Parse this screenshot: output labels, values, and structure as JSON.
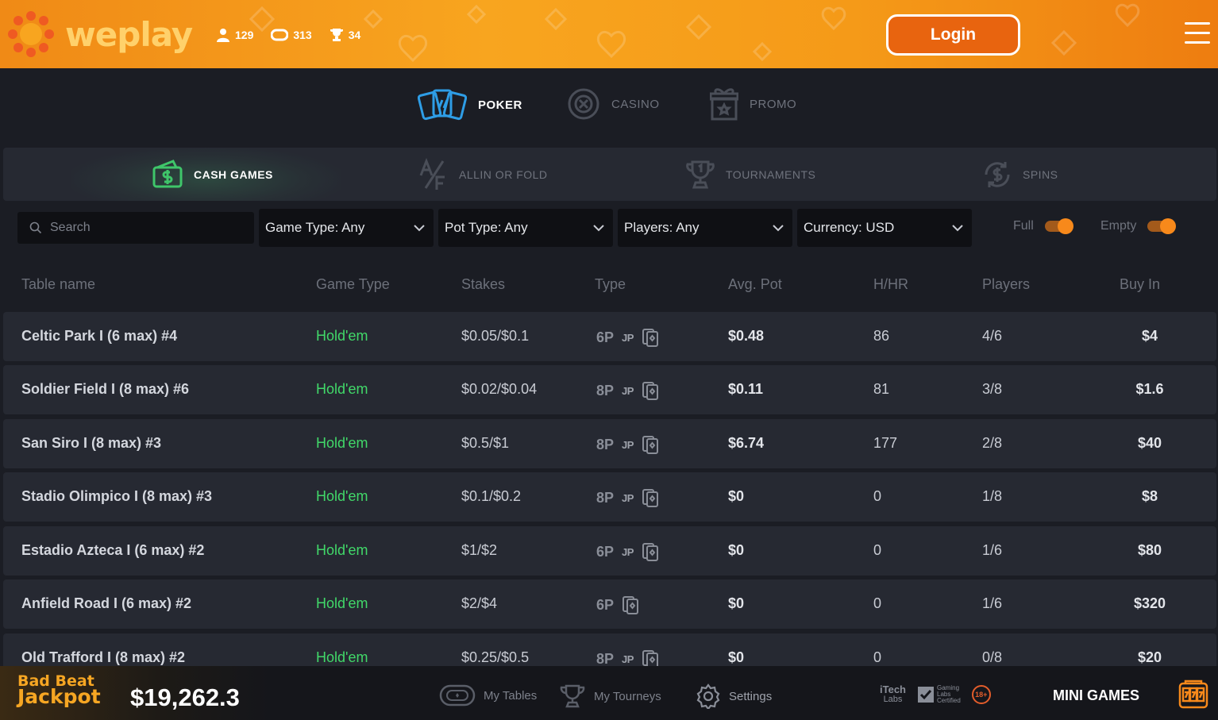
{
  "header": {
    "brand": "weplay",
    "stats": [
      {
        "icon": "user-icon",
        "value": "129"
      },
      {
        "icon": "ticket-icon",
        "value": "313"
      },
      {
        "icon": "trophy-icon",
        "value": "34"
      }
    ],
    "login_label": "Login"
  },
  "topnav": {
    "items": [
      {
        "label": "POKER",
        "icon": "cards-icon",
        "active": true
      },
      {
        "label": "CASINO",
        "icon": "chip-icon",
        "active": false
      },
      {
        "label": "PROMO",
        "icon": "gift-icon",
        "active": false
      }
    ]
  },
  "subtabs": {
    "items": [
      {
        "label": "CASH GAMES",
        "icon": "cash-icon",
        "active": true
      },
      {
        "label": "ALLIN OR FOLD",
        "icon": "af-icon",
        "active": false
      },
      {
        "label": "TOURNAMENTS",
        "icon": "trophy-icon",
        "active": false
      },
      {
        "label": "SPINS",
        "icon": "spin-dollar-icon",
        "active": false
      }
    ]
  },
  "filters": {
    "search_placeholder": "Search",
    "game_type": "Game Type: Any",
    "pot_type": "Pot Type: Any",
    "players": "Players: Any",
    "currency": "Currency: USD",
    "full_label": "Full",
    "empty_label": "Empty"
  },
  "table": {
    "headers": {
      "name": "Table name",
      "game": "Game Type",
      "stakes": "Stakes",
      "type": "Type",
      "pot": "Avg. Pot",
      "hhr": "H/HR",
      "players": "Players",
      "buyin": "Buy In"
    },
    "rows": [
      {
        "name": "Celtic Park I (6 max) #4",
        "game": "Hold'em",
        "stakes": "$0.05/$0.1",
        "type": "6P",
        "jp": "JP",
        "pot": "$0.48",
        "hhr": "86",
        "players": "4/6",
        "buyin": "$4"
      },
      {
        "name": "Soldier Field I (8 max) #6",
        "game": "Hold'em",
        "stakes": "$0.02/$0.04",
        "type": "8P",
        "jp": "JP",
        "pot": "$0.11",
        "hhr": "81",
        "players": "3/8",
        "buyin": "$1.6"
      },
      {
        "name": "San Siro I (8 max) #3",
        "game": "Hold'em",
        "stakes": "$0.5/$1",
        "type": "8P",
        "jp": "JP",
        "pot": "$6.74",
        "hhr": "177",
        "players": "2/8",
        "buyin": "$40"
      },
      {
        "name": "Stadio Olimpico I (8 max) #3",
        "game": "Hold'em",
        "stakes": "$0.1/$0.2",
        "type": "8P",
        "jp": "JP",
        "pot": "$0",
        "hhr": "0",
        "players": "1/8",
        "buyin": "$8"
      },
      {
        "name": "Estadio Azteca I (6 max) #2",
        "game": "Hold'em",
        "stakes": "$1/$2",
        "type": "6P",
        "jp": "JP",
        "pot": "$0",
        "hhr": "0",
        "players": "1/6",
        "buyin": "$80"
      },
      {
        "name": "Anfield Road I (6 max) #2",
        "game": "Hold'em",
        "stakes": "$2/$4",
        "type": "6P",
        "jp": "",
        "pot": "$0",
        "hhr": "0",
        "players": "1/6",
        "buyin": "$320"
      },
      {
        "name": "Old Trafford I (8 max) #2",
        "game": "Hold'em",
        "stakes": "$0.25/$0.5",
        "type": "8P",
        "jp": "JP",
        "pot": "$0",
        "hhr": "0",
        "players": "0/8",
        "buyin": "$20"
      }
    ]
  },
  "footer": {
    "jackpot_line1": "Bad Beat",
    "jackpot_line2": "Jackpot",
    "jackpot_amount": "$19,262.3",
    "my_tables": "My Tables",
    "my_tourneys": "My Tourneys",
    "settings": "Settings",
    "itech_line1": "iTech",
    "itech_line2": "Labs",
    "gaming_line1": "Gaming",
    "gaming_line2": "Labs",
    "gaming_line3": "Certified",
    "age": "18+",
    "mini_games": "MINI GAMES"
  },
  "colors": {
    "accent_orange": "#f7891b",
    "green": "#41d869",
    "bg": "#1b1d24",
    "row_bg": "#262932"
  }
}
